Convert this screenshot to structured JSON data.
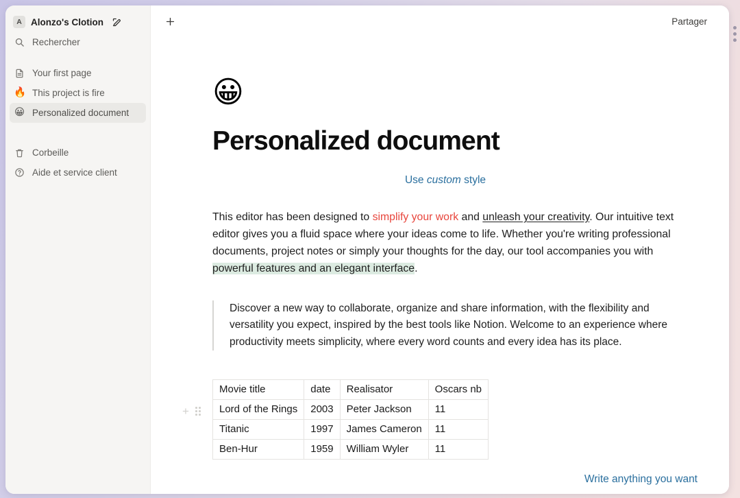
{
  "sidebar": {
    "workspace": {
      "avatar_letter": "A",
      "name": "Alonzo's Clotion",
      "edit_icon": "edit-square-icon"
    },
    "search": {
      "label": "Rechercher",
      "icon": "search-icon"
    },
    "pages": [
      {
        "label": "Your first page",
        "icon": "document-icon",
        "emoji": "",
        "active": false
      },
      {
        "label": "This project is fire",
        "icon": "",
        "emoji": "🔥",
        "active": false
      },
      {
        "label": "Personalized document",
        "icon": "",
        "emoji": "😀",
        "active": true
      }
    ],
    "footer": [
      {
        "label": "Corbeille",
        "icon": "trash-icon"
      },
      {
        "label": "Aide et service client",
        "icon": "question-circle-icon"
      }
    ]
  },
  "topbar": {
    "add_page_label": "+",
    "add_page_icon": "plus-icon",
    "share_label": "Partager",
    "window_dots_icon": "more-vertical-dots-icon"
  },
  "document": {
    "emoji": "😀",
    "title": "Personalized document",
    "subtitle": {
      "prefix": "Use ",
      "italic": "custom",
      "suffix": " style"
    },
    "paragraph": {
      "seg1": "This editor has been designed to ",
      "seg2_red": "simplify your work",
      "seg3": " and ",
      "seg4_underline": "unleash your creativity",
      "seg5": ". Our intuitive text editor gives you a fluid space where your ideas come to life. Whether you're writing professional documents, project notes or simply your thoughts for the day, our tool accompanies you with ",
      "seg6_highlight": "powerful features and an elegant interface",
      "seg7": "."
    },
    "quote": "Discover a new way to collaborate, organize and share information, with the flexibility and versatility you expect, inspired by the best tools like Notion. Welcome to an experience where productivity meets simplicity, where every word counts and every idea has its place.",
    "table": {
      "headers": [
        "Movie title",
        "date",
        "Realisator",
        "Oscars nb"
      ],
      "rows": [
        [
          "Lord of the Rings",
          "2003",
          "Peter Jackson",
          "11"
        ],
        [
          "Titanic",
          "1997",
          "James Cameron",
          "11"
        ],
        [
          "Ben-Hur",
          "1959",
          "William Wyler",
          "11"
        ]
      ]
    },
    "footer_note": "Write anything you want"
  },
  "colors": {
    "accent_blue": "#2a6f9e",
    "red": "#e8453c",
    "highlight_green": "#dcebe1",
    "sidebar_bg": "#f6f5f3",
    "sidebar_active": "#eae9e6"
  }
}
